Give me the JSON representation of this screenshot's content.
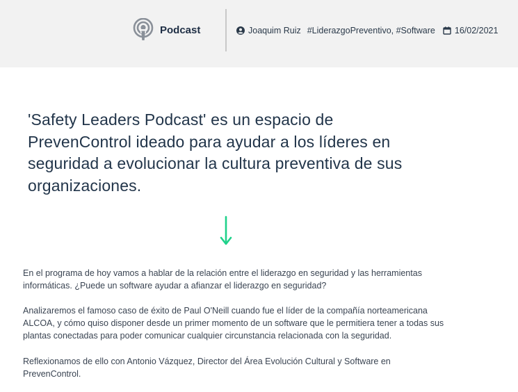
{
  "header": {
    "brand_label": "Podcast",
    "author": "Joaquim Ruiz",
    "tags": "#LiderazgoPreventivo, #Software",
    "date": "16/02/2021",
    "icons": {
      "brand": "podcast-icon",
      "author": "user-circle-icon",
      "date": "calendar-icon"
    }
  },
  "article": {
    "lead": "'Safety Leaders Podcast' es un espacio de PrevenControl ideado para ayudar a los líderes en seguridad a evolucionar la cultura preventiva de sus organizaciones.",
    "paragraphs": [
      "En el programa de hoy vamos a hablar de la relación entre el liderazgo en seguridad y las herramientas informáticas. ¿Puede un software ayudar a afianzar el liderazgo en seguridad?",
      "Analizaremos el famoso caso de éxito de Paul O'Neill cuando fue el líder de la compañía norteamericana ALCOA, y cómo quiso disponer desde un primer momento de un software que le permitiera tener a todas sus plantas conectadas para poder comunicar cualquier circunstancia relacionada con la seguridad.",
      "Reflexionamos de ello con Antonio Vázquez, Director del Área Evolución Cultural y Software en PrevenControl."
    ],
    "arrow_icon": "arrow-down-icon"
  },
  "colors": {
    "header_bg": "#f2f2f2",
    "accent_green": "#1fd18a",
    "text_dark": "#22354a"
  }
}
